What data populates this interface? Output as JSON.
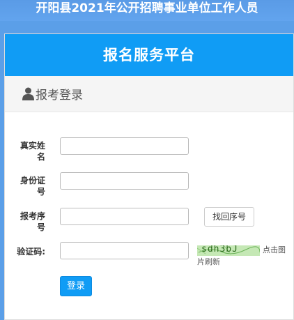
{
  "banner": {
    "title": "开阳县2021年公开招聘事业单位工作人员"
  },
  "card": {
    "header_title": "报名服务平台",
    "subheader": "报考登录"
  },
  "form": {
    "name_label_line1": "真实姓",
    "name_label_line2": "名",
    "name_value": "",
    "id_label_line1": "身份证",
    "id_label_line2": "号",
    "id_value": "",
    "seq_label_line1": "报考序",
    "seq_label_line2": "号",
    "seq_value": "",
    "recover_button": "找回序号",
    "captcha_label": "验证码:",
    "captcha_value": "",
    "captcha_image_text": "sdh3bJ",
    "captcha_hint_part1": "点击图",
    "captcha_hint_part2": "片刷新",
    "login_button": "登录"
  },
  "colors": {
    "banner_bg": "#5b9fe8",
    "header_bg": "#109cf5",
    "button_bg": "#109cf5",
    "captcha_bg": "#c5e8b5"
  },
  "icons": {
    "user": "person-icon"
  }
}
